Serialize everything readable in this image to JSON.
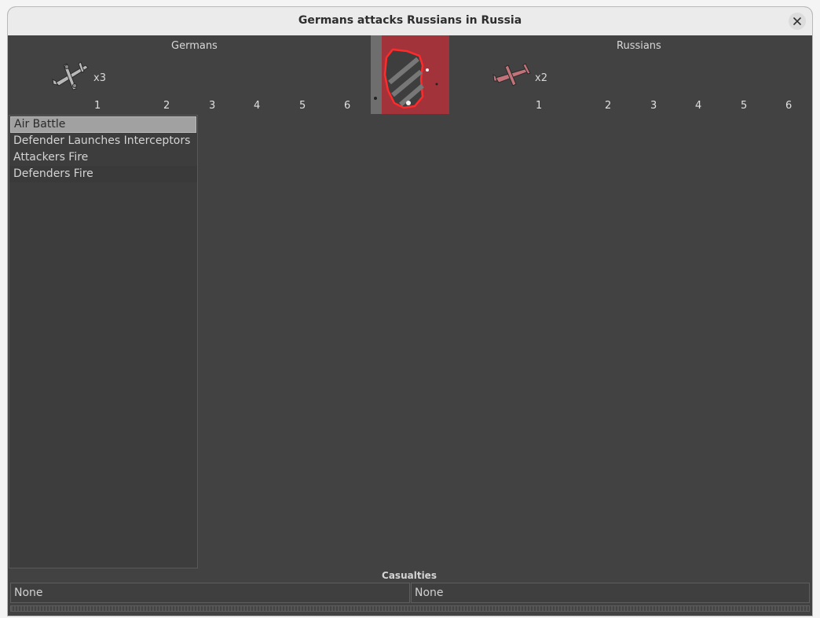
{
  "window": {
    "title": "Germans attacks Russians in Russia"
  },
  "attacker": {
    "name": "Germans",
    "unit_icon": "bomber-plane-icon",
    "unit_count": "x3",
    "color": "#b0b0b0"
  },
  "defender": {
    "name": "Russians",
    "unit_icon": "fighter-plane-icon",
    "unit_count": "x2",
    "color": "#c2737a"
  },
  "dice_labels": {
    "d1": "1",
    "d2": "2",
    "d3": "3",
    "d4": "4",
    "d5": "5",
    "d6": "6"
  },
  "terrain": {
    "icon": "territory-tile-icon",
    "color": "#a3333a",
    "border_color": "#ff2a2a"
  },
  "steps": [
    {
      "label": "Air Battle",
      "selected": true
    },
    {
      "label": "Defender Launches Interceptors"
    },
    {
      "label": "Attackers Fire"
    },
    {
      "label": "Defenders Fire"
    }
  ],
  "casualties": {
    "title": "Casualties",
    "attacker": "None",
    "defender": "None"
  }
}
